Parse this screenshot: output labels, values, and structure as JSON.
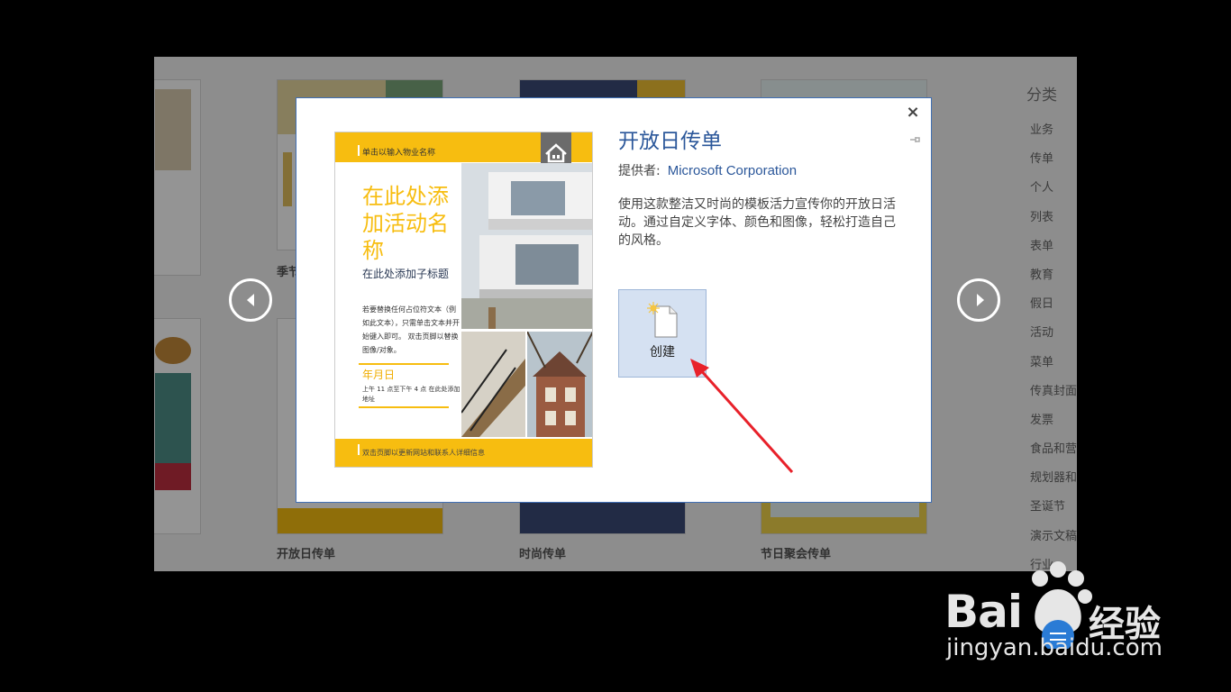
{
  "background": {
    "category_title": "分类",
    "categories": [
      "业务",
      "传单",
      "个人",
      "列表",
      "表单",
      "教育",
      "假日",
      "活动",
      "菜单",
      "传真封面",
      "发票",
      "食品和营养",
      "规划器和",
      "圣诞节",
      "演示文稿",
      "行业"
    ],
    "tiles": [
      {
        "caption": ""
      },
      {
        "caption": "季节"
      },
      {
        "caption": "开放日传单"
      },
      {
        "caption": "时尚传单"
      },
      {
        "caption": "节日聚会传单"
      }
    ]
  },
  "dialog": {
    "title": "开放日传单",
    "provider_label": "提供者:",
    "provider_value": "Microsoft Corporation",
    "description": "使用这款整洁又时尚的模板活力宣传你的开放日活动。通过自定义字体、颜色和图像，轻松打造自己的风格。",
    "create_label": "创建",
    "close_symbol": "×"
  },
  "flyer": {
    "top_text": "单击以输入物业名称",
    "heading": "在此处添加活动名称",
    "subtitle": "在此处添加子标题",
    "body": "若要替换任何占位符文本（例如此文本），只需单击文本并开始键入即可。 双击页脚以替换图像/对象。",
    "date": "年月日",
    "time": "上午 11 点至下午 4 点 在此处添加地址",
    "footer": "双击页脚以更新网站和联系人详细信息"
  },
  "watermark": {
    "brand": "Bai",
    "brand2": "经验",
    "url": "jingyan.baidu.com"
  },
  "colors": {
    "accent_blue": "#2b579a",
    "flyer_yellow": "#f7bd10",
    "annotation_red": "#e8212a"
  },
  "icons": [
    "close-icon",
    "pin-icon",
    "new-document-icon",
    "house-icon",
    "arrow-left-icon",
    "arrow-right-icon",
    "baidu-paw-icon"
  ]
}
